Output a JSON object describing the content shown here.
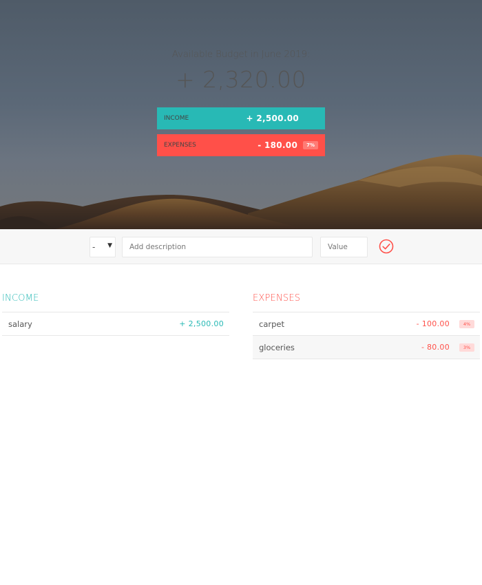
{
  "budget": {
    "title": "Available Budget in June 2019:",
    "value": "+ 2,320.00",
    "income_label": "Income",
    "income_value": "+ 2,500.00",
    "expenses_label": "Expenses",
    "expenses_value": "- 180.00",
    "expenses_percentage": "7%"
  },
  "add": {
    "type_value": "-",
    "description_placeholder": "Add description",
    "value_placeholder": "Value",
    "submit_icon": "checkmark-circle-icon"
  },
  "income": {
    "title": "Income",
    "items": [
      {
        "description": "salary",
        "value": "+ 2,500.00"
      }
    ]
  },
  "expenses": {
    "title": "Expenses",
    "items": [
      {
        "description": "carpet",
        "value": "- 100.00",
        "percentage": "4%"
      },
      {
        "description": "gloceries",
        "value": "- 80.00",
        "percentage": "3%"
      }
    ]
  },
  "colors": {
    "income": "#28b9b5",
    "expenses": "#ff5049"
  }
}
